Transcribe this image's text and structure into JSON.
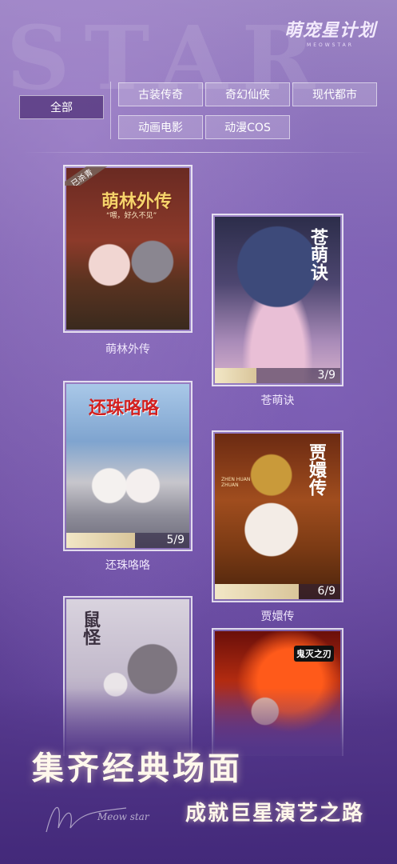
{
  "brand": {
    "watermark": "STAR",
    "logo_title": "萌宠星计划",
    "logo_sub": "MEOWSTAR"
  },
  "filters": {
    "all": "全部",
    "tabs": [
      "古装传奇",
      "奇幻仙侠",
      "现代都市",
      "动画电影",
      "动漫COS"
    ]
  },
  "cards": [
    {
      "title": "萌林外传",
      "badge": "已杀青",
      "poster_title": "萌林外传",
      "poster_sub": "“喂，好久不见”"
    },
    {
      "title": "苍萌诀",
      "progress_text": "3/9",
      "progress": 0.333,
      "poster_title": "苍萌诀"
    },
    {
      "title": "还珠咯咯",
      "progress_text": "5/9",
      "progress": 0.556,
      "poster_title": "还珠咯咯"
    },
    {
      "title": "贾嬛传",
      "progress_text": "6/9",
      "progress": 0.667,
      "poster_title": "贾嬛传",
      "poster_sub": "ZHEN HUAN ZHUAN"
    },
    {
      "title": "",
      "poster_title": "鼠怪"
    },
    {
      "title": "",
      "poster_title": "鬼灭之刃"
    }
  ],
  "slogan": {
    "line1": "集齐经典场面",
    "line2": "成就巨星演艺之路",
    "signature": "Meow star"
  },
  "colors": {
    "bg_top": "#9d86c4",
    "bg_bottom": "#3b2470",
    "progress_fill": "#efe2bf",
    "tab_active": "#50327a"
  }
}
